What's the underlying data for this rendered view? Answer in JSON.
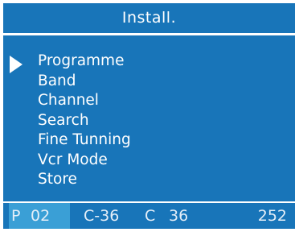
{
  "title": "Install.",
  "menu": {
    "items": [
      "Programme",
      "Band",
      "Channel",
      "Search",
      "Fine Tunning",
      "Vcr Mode",
      "Store"
    ],
    "selected": "Programme"
  },
  "status": {
    "prog_prefix": "P",
    "prog_number": "02",
    "channel_a": "C-36",
    "channel_b_prefix": "C",
    "channel_b_value": "36",
    "value": "252"
  },
  "colors": {
    "panel": "#1875b9",
    "highlight": "#3a9fd6",
    "text": "#ffffff"
  }
}
